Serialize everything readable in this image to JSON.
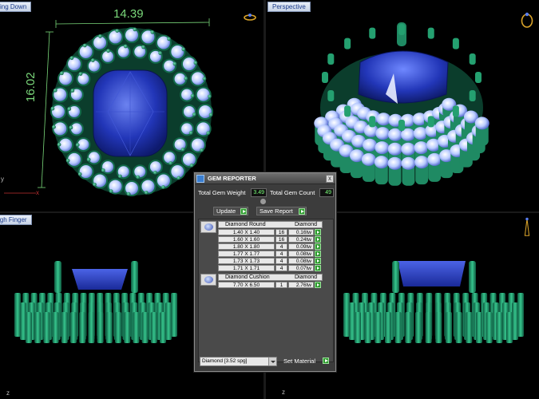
{
  "viewports": {
    "top_left": {
      "label": "ing Down",
      "dim_width": "14.39",
      "dim_height": "16.02",
      "axis": "y",
      "axis2": "x"
    },
    "top_right": {
      "label": "Perspective"
    },
    "bottom_left": {
      "label": "igh Finger",
      "axis": "z"
    },
    "bottom_right": {
      "axis": "z"
    }
  },
  "gem_reporter": {
    "title": "GEM REPORTER",
    "close": "x",
    "total_weight_label": "Total Gem Weight",
    "total_weight_value": "3.49",
    "total_count_label": "Total Gem Count",
    "total_count_value": "49",
    "update_label": "Update",
    "save_report_label": "Save Report",
    "groups": [
      {
        "shape": "Diamond Round",
        "material": "Diamond",
        "rows": [
          {
            "size": "1.40 X 1.40",
            "count": "16",
            "weight": "0.16tw"
          },
          {
            "size": "1.60 X 1.60",
            "count": "16",
            "weight": "0.24tw"
          },
          {
            "size": "1.80 X 1.80",
            "count": "4",
            "weight": "0.09tw"
          },
          {
            "size": "1.77 X 1.77",
            "count": "4",
            "weight": "0.08tw"
          },
          {
            "size": "1.73 X 1.73",
            "count": "4",
            "weight": "0.08tw"
          },
          {
            "size": "1.71 X 1.71",
            "count": "4",
            "weight": "0.07tw"
          }
        ]
      },
      {
        "shape": "Diamond Cushion",
        "material": "Diamond",
        "rows": [
          {
            "size": "7.70 X 6.50",
            "count": "1",
            "weight": "2.76tw"
          }
        ]
      }
    ],
    "material_select": "Diamond   [3.52 spg]",
    "set_material_label": "Set Material"
  },
  "colors": {
    "metal": "#1f8a63",
    "center_stone": "#2236b8",
    "diamond": "#c8d8ff",
    "dimension": "#7ad87a",
    "accent_green": "#2f9a2f"
  },
  "icons": [
    "ring-icon",
    "finger-ring-icon",
    "close-icon",
    "play-icon",
    "dropdown-icon"
  ]
}
